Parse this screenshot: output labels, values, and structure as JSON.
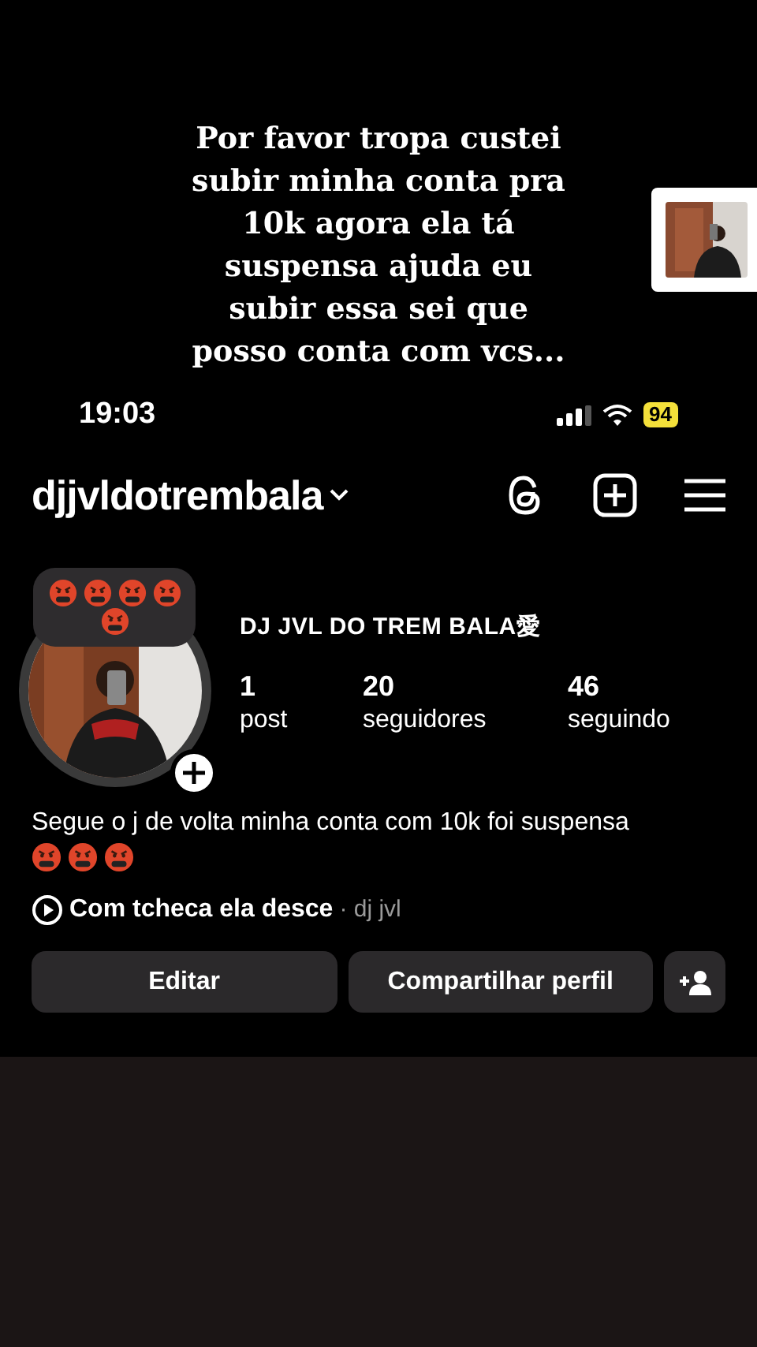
{
  "caption": "Por favor tropa custei subir minha conta pra 10k agora ela tá suspensa ajuda eu subir essa sei que posso conta com vcs...",
  "status_bar": {
    "time": "19:03",
    "battery": "94"
  },
  "header": {
    "username": "djjvldotrembala"
  },
  "profile": {
    "display_name": "DJ JVL DO TREM BALA愛",
    "stats": [
      {
        "value": "1",
        "label": "post"
      },
      {
        "value": "20",
        "label": "seguidores"
      },
      {
        "value": "46",
        "label": "seguindo"
      }
    ]
  },
  "bio": "Segue o j de volta minha conta com 10k foi suspensa",
  "music": {
    "title": "Com tcheca ela desce",
    "artist": "· dj jvl"
  },
  "buttons": [
    "Editar",
    "Compartilhar perfil"
  ]
}
